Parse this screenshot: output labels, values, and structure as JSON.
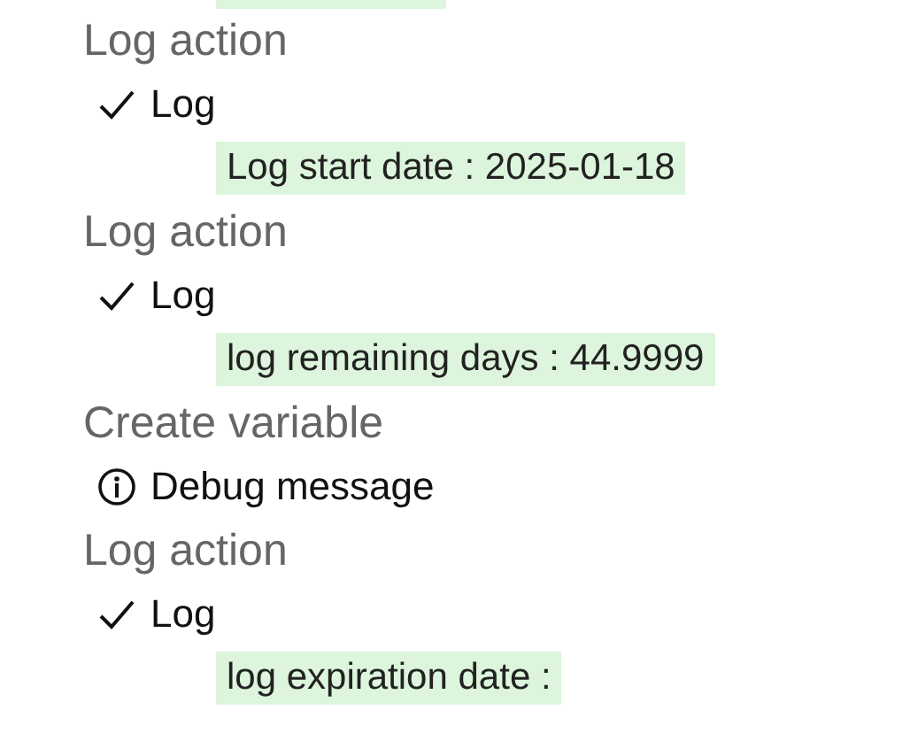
{
  "steps": [
    {
      "title": "Log action",
      "result": {
        "kind": "check",
        "label": "Log"
      },
      "message": "Log start date : 2025-01-18"
    },
    {
      "title": "Log action",
      "result": {
        "kind": "check",
        "label": "Log"
      },
      "message": "log remaining days : 44.9999"
    },
    {
      "title": "Create variable",
      "result": {
        "kind": "info",
        "label": "Debug message"
      }
    },
    {
      "title": "Log action",
      "result": {
        "kind": "check",
        "label": "Log"
      },
      "message": "log expiration date :"
    }
  ]
}
